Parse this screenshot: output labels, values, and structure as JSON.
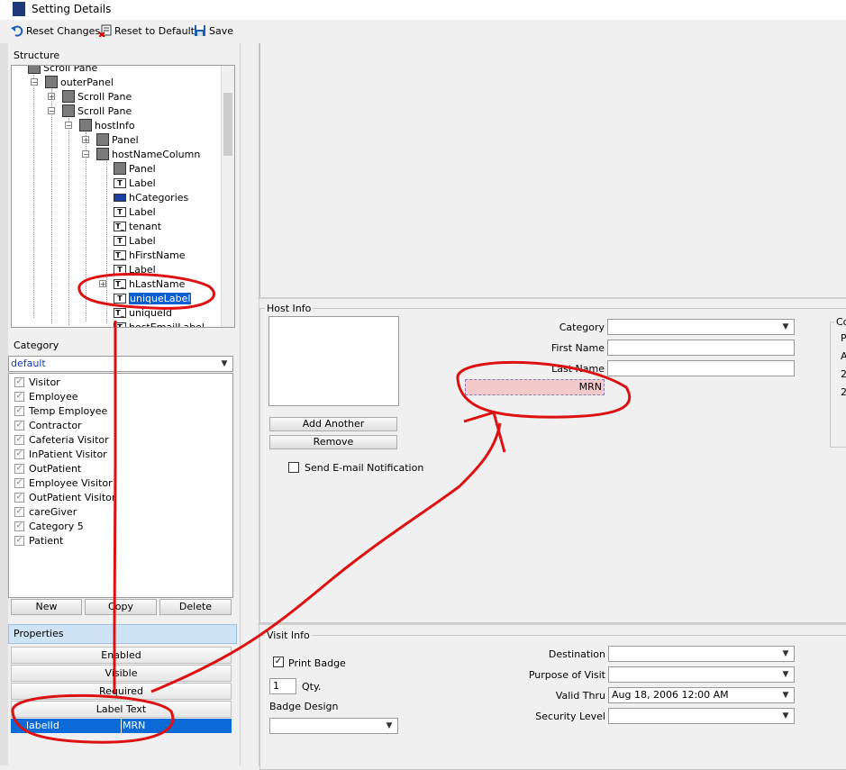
{
  "window": {
    "title": "Setting Details"
  },
  "toolbar": {
    "reset_changes": "Reset Changes",
    "reset_default": "Reset to Default",
    "save": "Save"
  },
  "structure": {
    "heading": "Structure",
    "nodes": [
      "Scroll Pane",
      "outerPanel",
      "Scroll Pane",
      "Scroll Pane",
      "hostInfo",
      "Panel",
      "hostNameColumn",
      "Panel",
      "Label",
      "hCategories",
      "Label",
      "tenant",
      "Label",
      "hFirstName",
      "Label",
      "hLastName",
      "uniqueLabel",
      "uniqueId",
      "hostEmailLabel"
    ]
  },
  "category": {
    "heading": "Category",
    "selected": "default",
    "items": [
      "Visitor",
      "Employee",
      "Temp Employee",
      "Contractor",
      "Cafeteria Visitor",
      "InPatient Visitor",
      "OutPatient",
      "Employee Visitor",
      "OutPatient Visitor",
      "careGiver",
      "Category 5",
      "Patient"
    ],
    "buttons": {
      "new": "New",
      "copy": "Copy",
      "delete": "Delete"
    }
  },
  "properties": {
    "heading": "Properties",
    "rows": [
      "Enabled",
      "Visible",
      "Required",
      "Label Text"
    ],
    "selected_key": "labelId",
    "selected_value": "MRN"
  },
  "host_info": {
    "title": "Host Info",
    "add_another": "Add Another",
    "remove": "Remove",
    "send_email": "Send E-mail Notification",
    "category_label": "Category",
    "first_name_label": "First Name",
    "last_name_label": "Last Name",
    "mrn_label": "MRN",
    "right_partial": {
      "title": "Co",
      "lines": [
        "P",
        "A",
        "2",
        "2"
      ]
    }
  },
  "visit_info": {
    "title": "Visit Info",
    "print_badge": "Print Badge",
    "qty_value": "1",
    "qty_label": "Qty.",
    "badge_design": "Badge Design",
    "destination": "Destination",
    "purpose": "Purpose of Visit",
    "valid_thru": "Valid Thru",
    "valid_thru_value": "Aug 18, 2006 12:00 AM",
    "security_level": "Security Level"
  },
  "colors": {
    "annotation": "#dd1111",
    "selection": "#0a6ad8",
    "highlight": "#f4c9c9"
  }
}
